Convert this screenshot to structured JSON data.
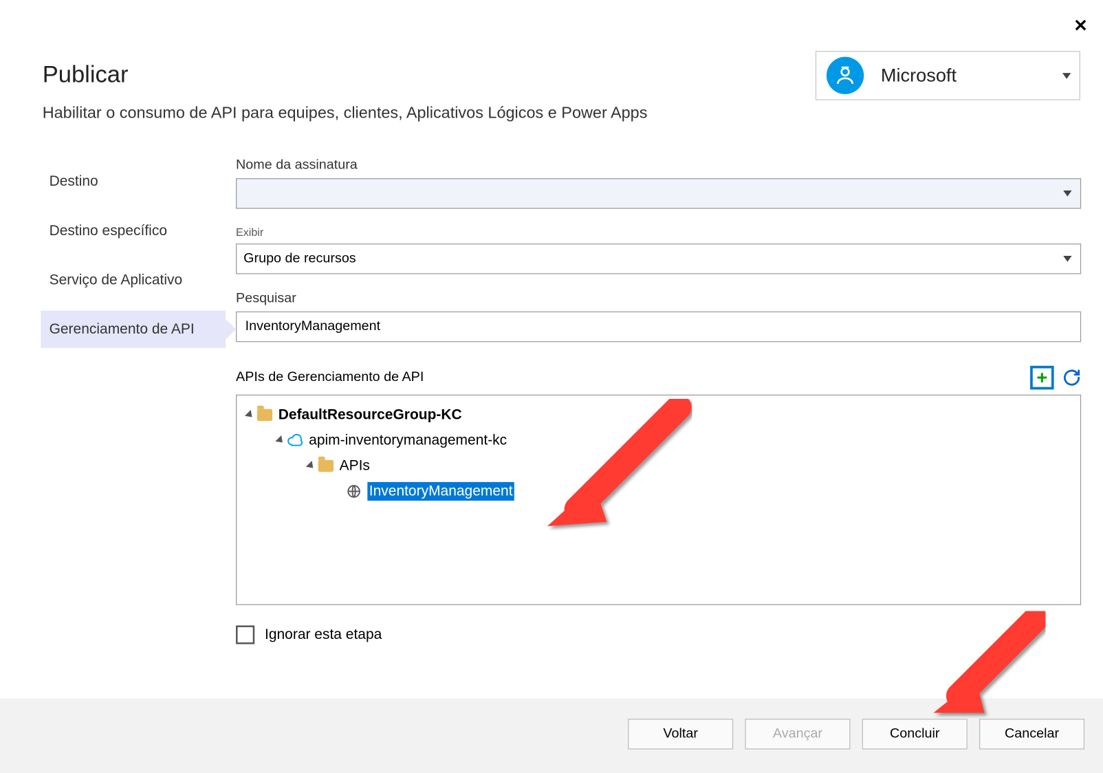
{
  "dialog": {
    "title": "Publicar",
    "subtitle": "Habilitar o consumo de API para equipes, clientes, Aplicativos Lógicos e Power Apps"
  },
  "account": {
    "name": "Microsoft"
  },
  "sidebar": {
    "items": [
      {
        "label": "Destino"
      },
      {
        "label": "Destino específico"
      },
      {
        "label": "Serviço de Aplicativo"
      },
      {
        "label": "Gerenciamento de API"
      }
    ]
  },
  "form": {
    "subscription_label": "Nome da assinatura",
    "subscription_value": "",
    "view_label": "Exibir",
    "view_value": "Grupo de recursos",
    "search_label": "Pesquisar",
    "search_value": "InventoryManagement",
    "tree_label": "APIs de Gerenciamento de API",
    "skip_label": "Ignorar esta etapa"
  },
  "tree": {
    "root": "DefaultResourceGroup-KC",
    "service": "apim-inventorymanagement-kc",
    "folder": "APIs",
    "selected": "InventoryManagement"
  },
  "footer": {
    "back": "Voltar",
    "next": "Avançar",
    "finish": "Concluir",
    "cancel": "Cancelar"
  }
}
